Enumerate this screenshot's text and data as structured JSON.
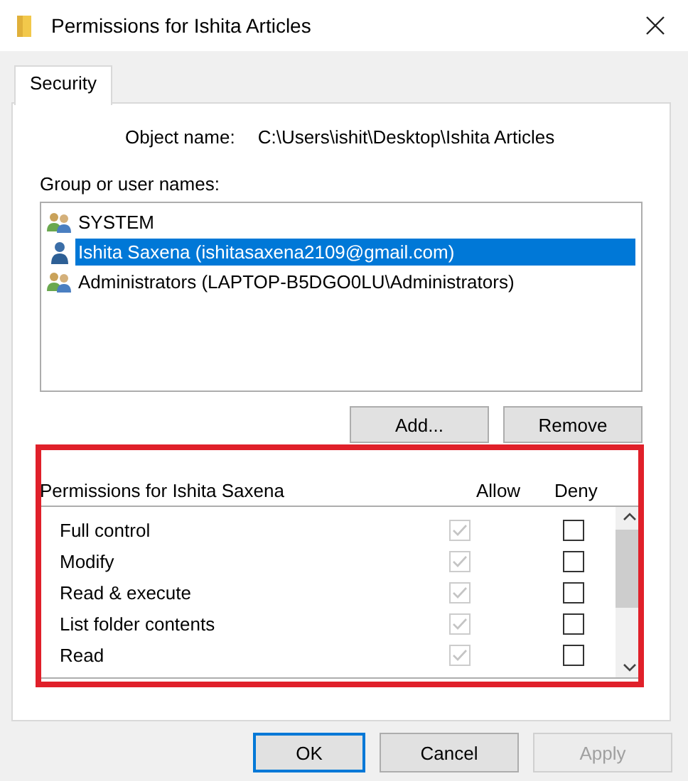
{
  "window": {
    "title": "Permissions for Ishita Articles"
  },
  "tabs": [
    {
      "label": "Security",
      "selected": true
    }
  ],
  "object_name": {
    "label": "Object name:",
    "value": "C:\\Users\\ishit\\Desktop\\Ishita Articles"
  },
  "group_list": {
    "label": "Group or user names:",
    "items": [
      {
        "name": "SYSTEM",
        "kind": "group",
        "selected": false
      },
      {
        "name": "Ishita Saxena (ishitasaxena2109@gmail.com)",
        "kind": "user",
        "selected": true
      },
      {
        "name": "Administrators (LAPTOP-B5DGO0LU\\Administrators)",
        "kind": "group",
        "selected": false
      }
    ]
  },
  "group_buttons": [
    "Add...",
    "Remove"
  ],
  "permissions": {
    "label": "Permissions for Ishita Saxena",
    "allow_label": "Allow",
    "deny_label": "Deny",
    "rows": [
      {
        "name": "Full control",
        "allow": true,
        "allow_disabled": true,
        "deny": false
      },
      {
        "name": "Modify",
        "allow": true,
        "allow_disabled": true,
        "deny": false
      },
      {
        "name": "Read & execute",
        "allow": true,
        "allow_disabled": true,
        "deny": false
      },
      {
        "name": "List folder contents",
        "allow": true,
        "allow_disabled": true,
        "deny": false
      },
      {
        "name": "Read",
        "allow": true,
        "allow_disabled": true,
        "deny": false
      }
    ]
  },
  "buttons": [
    {
      "label": "OK",
      "default": true,
      "disabled": false
    },
    {
      "label": "Cancel",
      "default": false,
      "disabled": false
    },
    {
      "label": "Apply",
      "default": false,
      "disabled": true
    }
  ]
}
